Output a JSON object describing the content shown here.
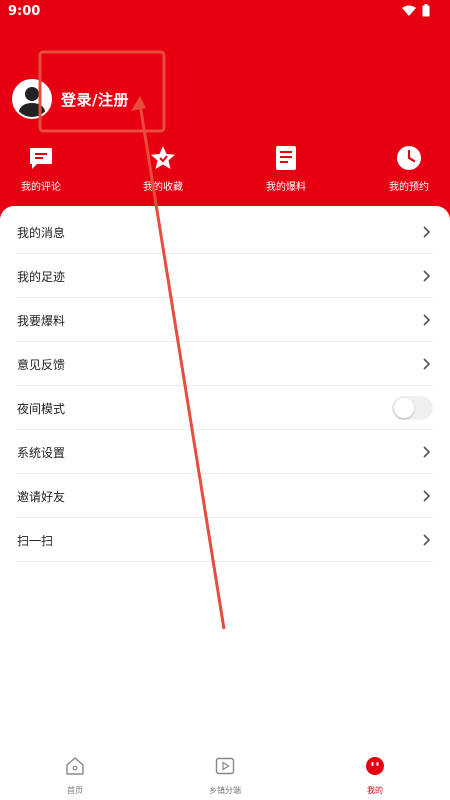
{
  "status_bar": {
    "time": "9:00"
  },
  "profile": {
    "login_label": "登录/注册"
  },
  "quick_actions": [
    {
      "label": "我的评论",
      "icon": "comment-icon"
    },
    {
      "label": "我的收藏",
      "icon": "star-icon"
    },
    {
      "label": "我的爆料",
      "icon": "document-icon"
    },
    {
      "label": "我的预约",
      "icon": "clock-icon"
    }
  ],
  "menu": [
    {
      "label": "我的消息"
    },
    {
      "label": "我的足迹"
    },
    {
      "label": "我要爆料"
    },
    {
      "label": "意见反馈"
    },
    {
      "label": "夜间模式",
      "toggle_on": false
    },
    {
      "label": "系统设置"
    },
    {
      "label": "邀请好友"
    },
    {
      "label": "扫一扫"
    }
  ],
  "bottom_nav": [
    {
      "label": "首页",
      "icon": "home-icon",
      "active": false
    },
    {
      "label": "乡镇分端",
      "icon": "play-icon",
      "active": false
    },
    {
      "label": "我的",
      "icon": "profile-icon",
      "active": true
    }
  ],
  "colors": {
    "brand_red": "#e60012",
    "annotation_red": "#e74c3c"
  }
}
